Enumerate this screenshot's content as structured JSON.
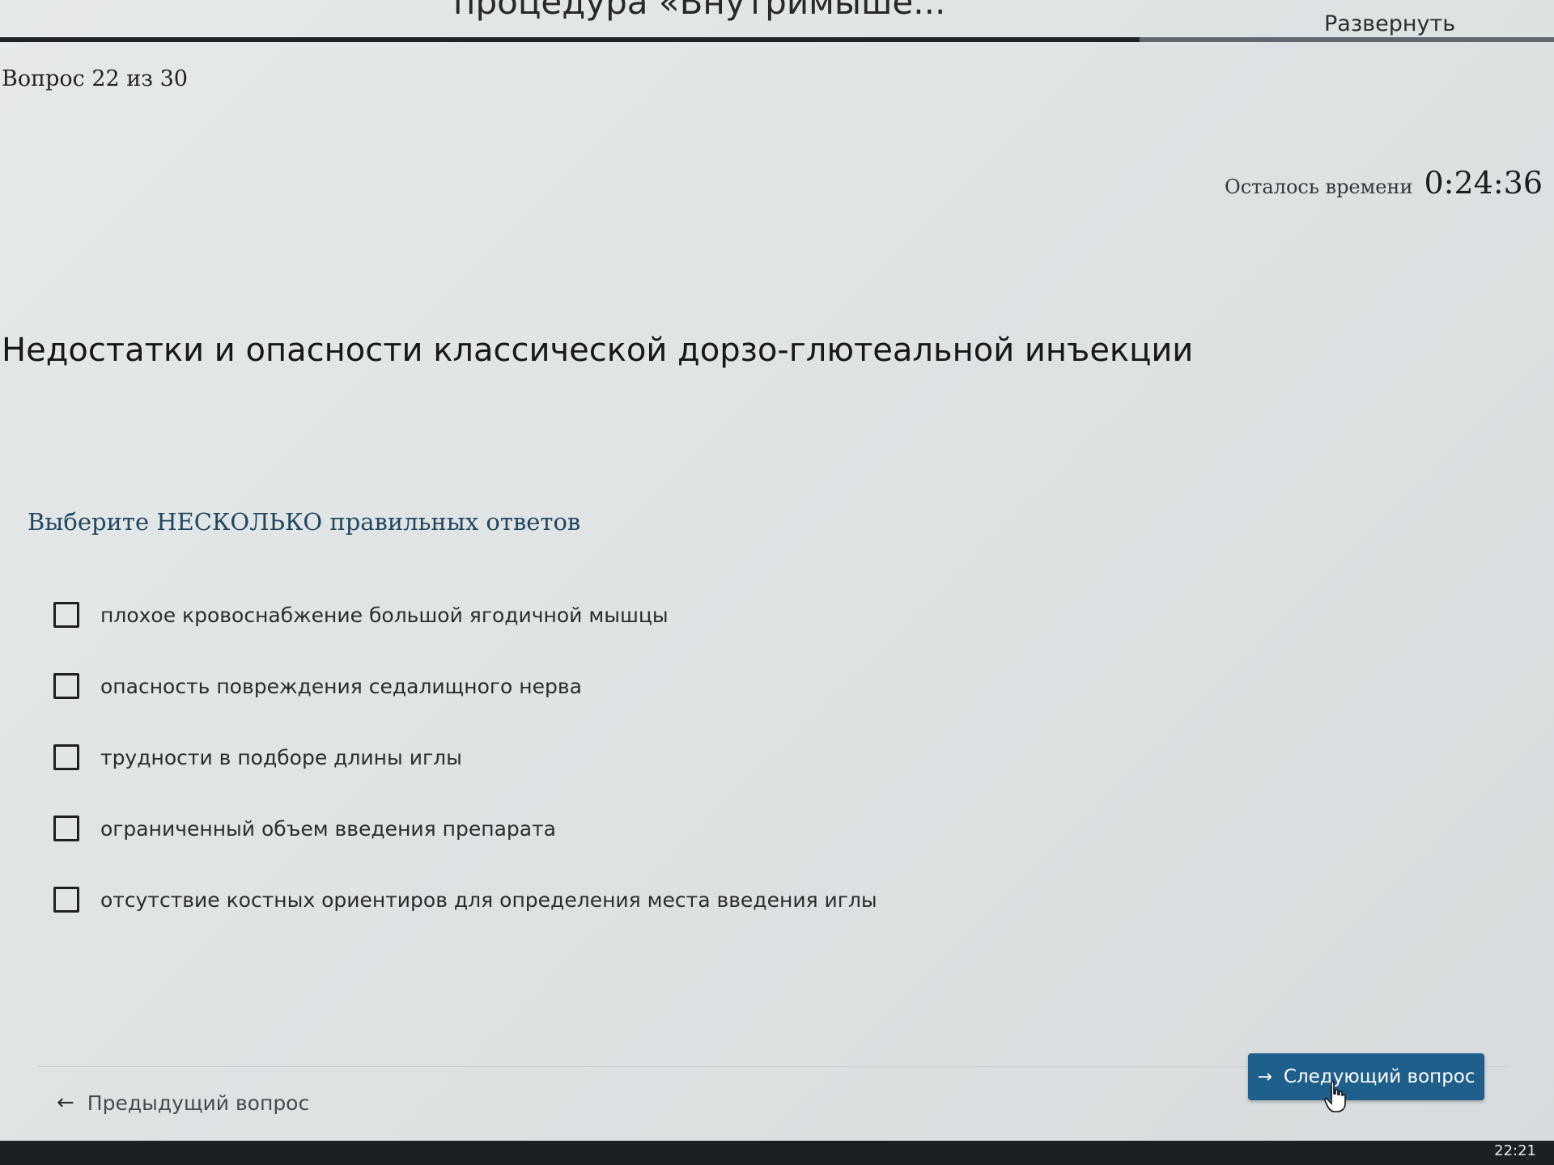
{
  "window": {
    "title": "процедура «Внутримыше...",
    "expand_label": "Развернуть"
  },
  "progress": {
    "current": 22,
    "total": 30,
    "fraction": 0.7333
  },
  "header": {
    "question_counter": "Вопрос 22 из 30",
    "timer_label": "Осталось времени",
    "timer_value": "0:24:36"
  },
  "question": {
    "title": "Недостатки и опасности классической дорзо-глютеальной инъекции",
    "instruction": "Выберите НЕСКОЛЬКО правильных ответов",
    "answers": [
      {
        "label": "плохое кровоснабжение большой ягодичной мышцы",
        "checked": false
      },
      {
        "label": "опасность повреждения седалищного нерва",
        "checked": false
      },
      {
        "label": "трудности в подборе длины иглы",
        "checked": false
      },
      {
        "label": "ограниченный объем введения препарата",
        "checked": false
      },
      {
        "label": "отсутствие костных ориентиров для определения места введения иглы",
        "checked": false
      }
    ]
  },
  "navigation": {
    "prev_label": "Предыдущий вопрос",
    "prev_icon": "arrow-left-icon",
    "next_label": "Следующий вопрос",
    "next_icon": "arrow-right-icon",
    "next_color": "#1e5f8c"
  },
  "taskbar": {
    "clock": "22:21"
  }
}
